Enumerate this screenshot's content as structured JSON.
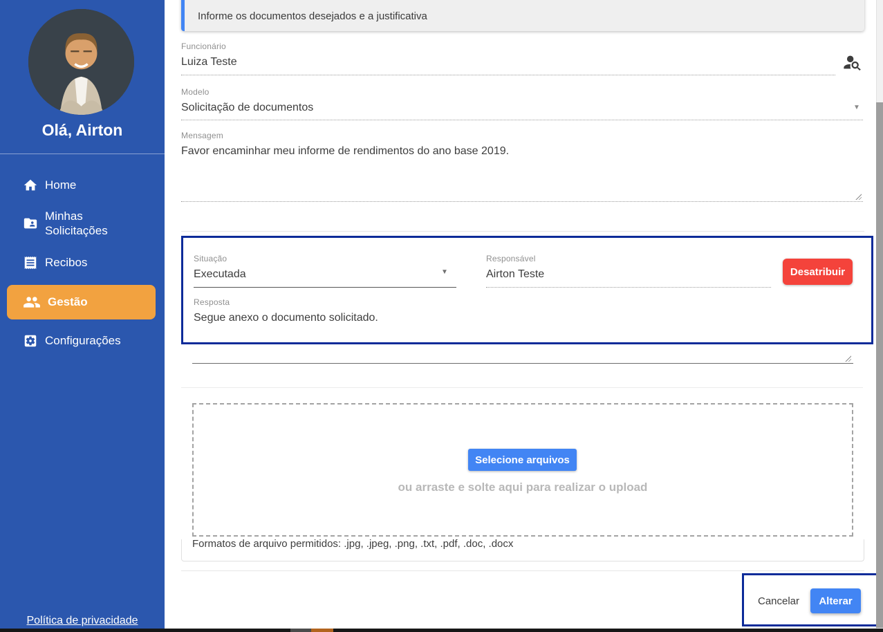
{
  "sidebar": {
    "greeting": "Olá, Airton",
    "items": [
      {
        "label": "Home",
        "icon": "home-icon",
        "active": false
      },
      {
        "label": "Minhas Solicitações",
        "icon": "folder-shared-icon",
        "active": false
      },
      {
        "label": "Recibos",
        "icon": "receipt-icon",
        "active": false
      },
      {
        "label": "Gestão",
        "icon": "people-icon",
        "active": true
      },
      {
        "label": "Configurações",
        "icon": "settings-icon",
        "active": false
      }
    ],
    "privacy_link": "Política de privacidade"
  },
  "banner": {
    "text": "Informe os documentos desejados e a justificativa"
  },
  "form": {
    "funcionario": {
      "label": "Funcionário",
      "value": "Luiza Teste",
      "icon": "person-search-icon"
    },
    "modelo": {
      "label": "Modelo",
      "value": "Solicitação de documentos"
    },
    "mensagem": {
      "label": "Mensagem",
      "value": "Favor encaminhar meu informe de rendimentos do ano base 2019."
    },
    "situacao": {
      "label": "Situação",
      "value": "Executada"
    },
    "responsavel": {
      "label": "Responsável",
      "value": "Airton Teste"
    },
    "desatribuir_button": "Desatribuir",
    "resposta": {
      "label": "Resposta",
      "value": "Segue anexo o documento solicitado."
    },
    "upload": {
      "select_button": "Selecione arquivos",
      "drop_hint": "ou arraste e solte aqui para realizar o upload",
      "formats": "Formatos de arquivo permitidos: .jpg, .jpeg, .png, .txt, .pdf, .doc, .docx"
    },
    "actions": {
      "cancel": "Cancelar",
      "submit": "Alterar"
    }
  },
  "colors": {
    "sidebar_blue": "#2B57AE",
    "active_orange": "#F2A240",
    "primary_blue": "#4285F4",
    "danger_red": "#F4433B",
    "highlight_navy": "#0C2B99",
    "banner_gray": "#EFEFEF"
  }
}
